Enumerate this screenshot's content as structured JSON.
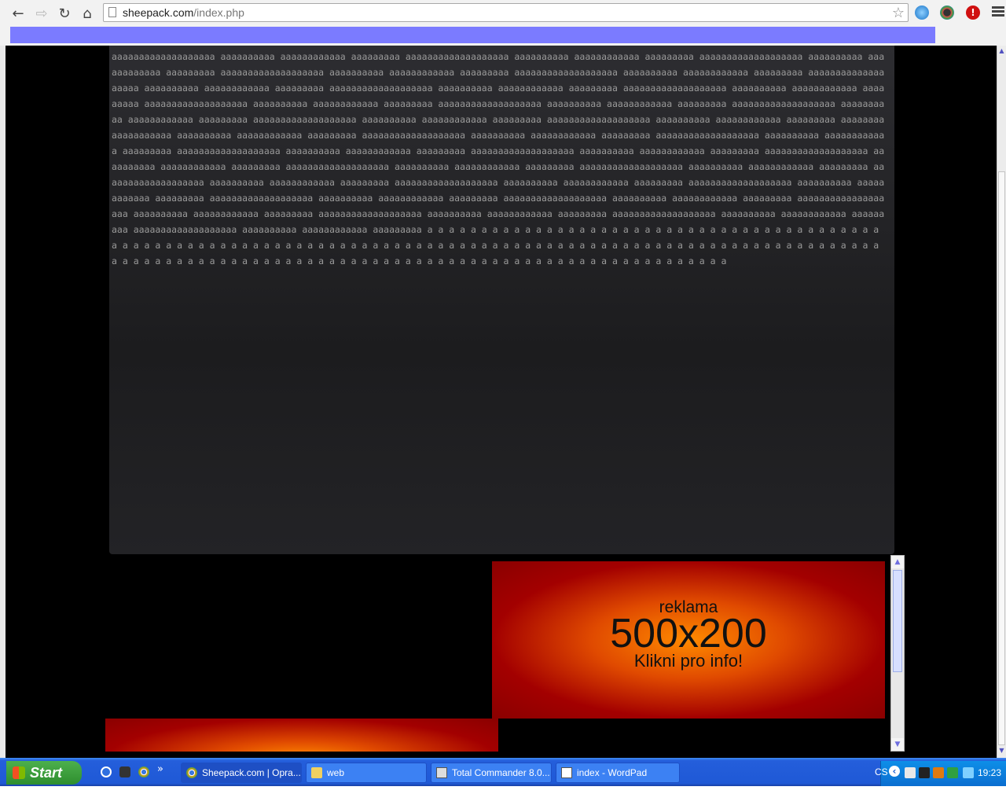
{
  "browser": {
    "url_domain": "sheepack.com",
    "url_path": "/index.php",
    "nav": {
      "back": "←",
      "forward": "⇨",
      "reload": "↻",
      "home": "⌂"
    },
    "icons": [
      "page-icon",
      "bookmark-star-icon",
      "extension-compass-icon",
      "extension-color-icon",
      "extension-alert-icon",
      "menu-icon"
    ],
    "bookmark_bar_color": "#7b7bff"
  },
  "page": {
    "body_text": "aaaaaaaaaaaaaaaaaaa aaaaaaaaaa aaaaaaaaaaaa aaaaaaaaa aaaaaaaaaaaaaaaaaaa aaaaaaaaaa aaaaaaaaaaaa aaaaaaaaa aaaaaaaaaaaaaaaaaaa aaaaaaaaaa aaaaaaaaaaaa aaaaaaaaa aaaaaaaaaaaaaaaaaaa aaaaaaaaaa aaaaaaaaaaaa aaaaaaaaa aaaaaaaaaaaaaaaaaaa aaaaaaaaaa aaaaaaaaaaaa aaaaaaaaa aaaaaaaaaaaaaaaaaaa aaaaaaaaaa aaaaaaaaaaaa aaaaaaaaa aaaaaaaaaaaaaaaaaaa aaaaaaaaaa aaaaaaaaaaaa aaaaaaaaa aaaaaaaaaaaaaaaaaaa aaaaaaaaaa aaaaaaaaaaaa aaaaaaaaa aaaaaaaaaaaaaaaaaaa aaaaaaaaaa aaaaaaaaaaaa aaaaaaaaa aaaaaaaaaaaaaaaaaaa aaaaaaaaaa aaaaaaaaaaaa aaaaaaaaa aaaaaaaaaaaaaaaaaaa aaaaaaaaaa aaaaaaaaaaaa aaaaaaaaa aaaaaaaaaaaaaaaaaaa aaaaaaaaaa aaaaaaaaaaaa aaaaaaaaa aaaaaaaaaaaaaaaaaaa aaaaaaaaaa aaaaaaaaaaaa aaaaaaaaa aaaaaaaaaaaaaaaaaaa aaaaaaaaaa aaaaaaaaaaaa aaaaaaaaa aaaaaaaaaaaaaaaaaaa aaaaaaaaaa aaaaaaaaaaaa aaaaaaaaa aaaaaaaaaaaaaaaaaaa aaaaaaaaaa aaaaaaaaaaaa aaaaaaaaa aaaaaaaaaaaaaaaaaaa aaaaaaaaaa aaaaaaaaaaaa aaaaaaaaa aaaaaaaaaaaaaaaaaaa aaaaaaaaaa aaaaaaaaaaaa aaaaaaaaa aaaaaaaaaaaaaaaaaaa aaaaaaaaaa aaaaaaaaaaaa aaaaaaaaa aaaaaaaaaaaaaaaaaaa aaaaaaaaaa aaaaaaaaaaaa aaaaaaaaa aaaaaaaaaaaaaaaaaaa aaaaaaaaaa aaaaaaaaaaaa aaaaaaaaa aaaaaaaaaaaaaaaaaaa aaaaaaaaaa aaaaaaaaaaaa aaaaaaaaa aaaaaaaaaaaaaaaaaaa aaaaaaaaaa aaaaaaaaaaaa aaaaaaaaa aaaaaaaaaaaaaaaaaaa aaaaaaaaaa aaaaaaaaaaaa aaaaaaaaa aaaaaaaaaaaaaaaaaaa aaaaaaaaaa aaaaaaaaaaaa aaaaaaaaa aaaaaaaaaaaaaaaaaaa aaaaaaaaaa aaaaaaaaaaaa aaaaaaaaa aaaaaaaaaaaaaaaaaaa aaaaaaaaaa aaaaaaaaaaaa aaaaaaaaa aaaaaaaaaaaaaaaaaaa aaaaaaaaaa aaaaaaaaaaaa aaaaaaaaa aaaaaaaaaaaaaaaaaaa aaaaaaaaaa aaaaaaaaaaaa aaaaaaaaa aaaaaaaaaaaaaaaaaaa aaaaaaaaaa aaaaaaaaaaaa aaaaaaaaa a a a a a a a a a a a a a a a a a a a a a a a a a a a a a a a a a a a a a a a a a a a a a a a a a a a a a a a a a a a a a a a a a a a a a a a a a a a a a a a a a a a a a a a a a a a a a a a a a a a a a a a a a a a a a a a a a a a a a a a a a a a a a a a a a a a a a a a a a a a a a a a a a a a a a a a a a a a a a a a a a a a a a a a a a a",
    "ad": {
      "line1": "reklama",
      "line2": "500x200",
      "line3": "Klikni pro info!"
    }
  },
  "taskbar": {
    "start_label": "Start",
    "quick_launch": [
      "ie-icon",
      "app-icon",
      "chrome-icon"
    ],
    "quick_launch_more": "»",
    "tasks": [
      {
        "label": "Sheepack.com | Opra...",
        "icon": "chrome-icon"
      },
      {
        "label": "web",
        "icon": "folder-icon"
      },
      {
        "label": "Total Commander 8.0...",
        "icon": "floppy-icon"
      },
      {
        "label": "index - WordPad",
        "icon": "wordpad-icon"
      }
    ],
    "tray": {
      "language": "CS",
      "expand": "‹",
      "clock": "19:23"
    }
  }
}
